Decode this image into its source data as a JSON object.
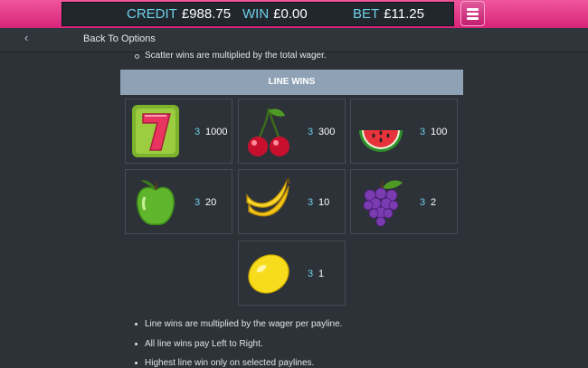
{
  "header_bar": {
    "credit_label": "CREDIT",
    "credit_value": "£988.75",
    "win_label": "WIN",
    "win_value": "£0.00",
    "bet_label": "BET",
    "bet_value": "£11.25",
    "menu_icon": "hamburger-menu-icon"
  },
  "nav": {
    "back_icon": "chevron-left-icon",
    "back_label": "Back To Options"
  },
  "scatter_note": "Scatter wins are multiplied by the total wager.",
  "section_title": "LINE WINS",
  "paytable": [
    {
      "symbol": "seven-icon",
      "count": "3",
      "payout": "1000"
    },
    {
      "symbol": "cherries-icon",
      "count": "3",
      "payout": "300"
    },
    {
      "symbol": "watermelon-icon",
      "count": "3",
      "payout": "100"
    },
    {
      "symbol": "apple-icon",
      "count": "3",
      "payout": "20"
    },
    {
      "symbol": "banana-icon",
      "count": "3",
      "payout": "10"
    },
    {
      "symbol": "grapes-icon",
      "count": "3",
      "payout": "2"
    },
    {
      "symbol": "lemon-icon",
      "count": "3",
      "payout": "1"
    }
  ],
  "rules": [
    "Line wins are multiplied by the wager per payline.",
    "All line wins pay Left to Right.",
    "Highest line win only on selected paylines."
  ],
  "colors": {
    "accent_pink": "#e33c89",
    "count_cyan": "#6fd0ea",
    "background": "#2c3238",
    "header_bg": "#8fa2b5"
  }
}
